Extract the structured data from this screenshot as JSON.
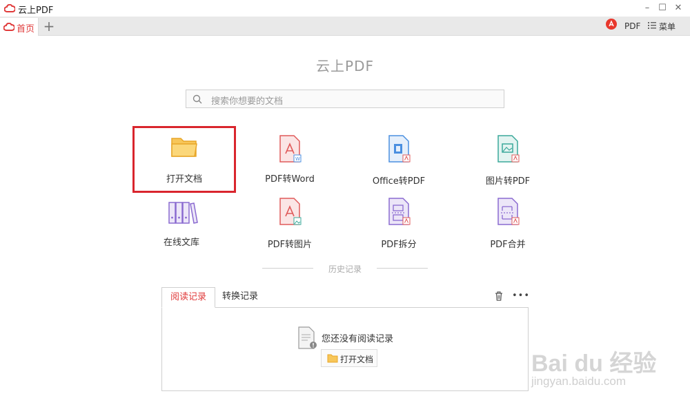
{
  "window": {
    "title": "云上PDF",
    "controls": [
      "minimize",
      "maximize",
      "close"
    ]
  },
  "tabs": {
    "home_label": "首页",
    "add_label": "+"
  },
  "topbar": {
    "pdf_label": "PDF",
    "menu_label": "菜单"
  },
  "main": {
    "heading": "云上PDF",
    "search_placeholder": "搜索你想要的文档"
  },
  "tools": [
    {
      "label": "打开文档",
      "icon": "folder-icon",
      "color": "#f2b134"
    },
    {
      "label": "PDF转Word",
      "icon": "pdf-to-word-icon",
      "color": "#e05a5a"
    },
    {
      "label": "Office转PDF",
      "icon": "office-to-pdf-icon",
      "color": "#4a8fe0"
    },
    {
      "label": "图片转PDF",
      "icon": "image-to-pdf-icon",
      "color": "#3aa89a"
    },
    {
      "label": "在线文库",
      "icon": "library-icon",
      "color": "#8a6ad0"
    },
    {
      "label": "PDF转图片",
      "icon": "pdf-to-image-icon",
      "color": "#e05a5a"
    },
    {
      "label": "PDF拆分",
      "icon": "pdf-split-icon",
      "color": "#8a6ad0"
    },
    {
      "label": "PDF合并",
      "icon": "pdf-merge-icon",
      "color": "#8a6ad0"
    }
  ],
  "history": {
    "title": "历史记录",
    "tab_read": "阅读记录",
    "tab_convert": "转换记录",
    "empty_text": "您还没有阅读记录",
    "open_button": "打开文档"
  },
  "watermark": {
    "brand": "Bai du 经验",
    "url": "jingyan.baidu.com"
  },
  "colors": {
    "accent": "#e03a3a",
    "highlight": "#d9252d"
  }
}
